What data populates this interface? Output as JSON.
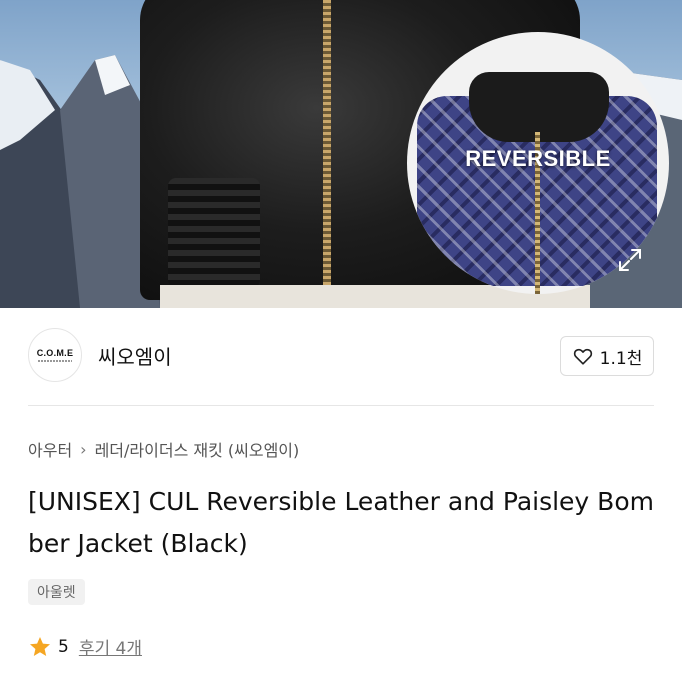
{
  "hero": {
    "badge_text": "REVERSIBLE",
    "expand_icon": "expand-icon"
  },
  "brand": {
    "logo_text": "C.O.M.E",
    "name": "씨오엠이"
  },
  "like": {
    "icon": "heart-icon",
    "count": "1.1천"
  },
  "breadcrumb": {
    "items": [
      "아우터",
      "레더/라이더스 재킷 (씨오엠이)"
    ],
    "separator_icon": "chevron-right-icon"
  },
  "product": {
    "title": "[UNISEX] CUL Reversible Leather and Paisley Bomber Jacket (Black)",
    "tag": "아울렛"
  },
  "rating": {
    "icon": "star-icon",
    "score": "5",
    "reviews_label": "후기 4개"
  },
  "colors": {
    "star": "#f5a623",
    "divider": "#e6e6e6",
    "tag_bg": "#f1f1f1"
  }
}
